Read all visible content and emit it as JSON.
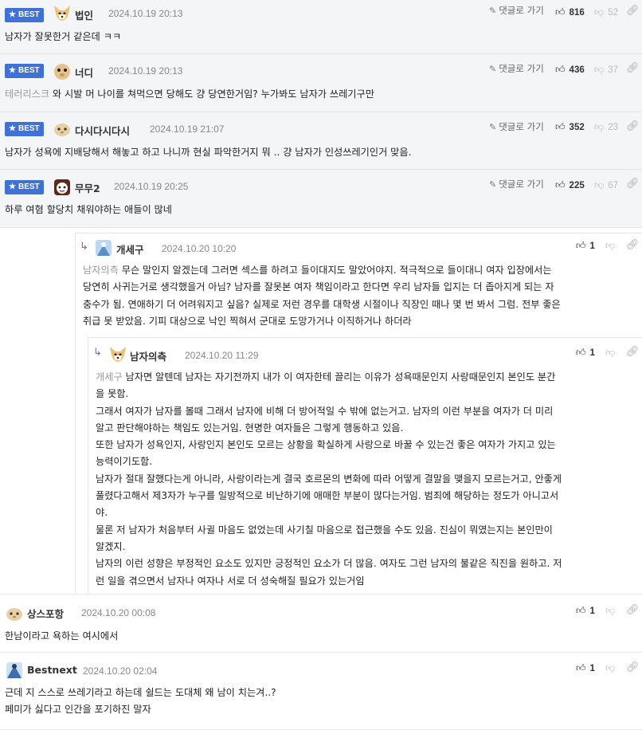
{
  "reply_link_label": "댓글로 가기",
  "badge_label": "BEST",
  "comments": [
    {
      "author": "법인",
      "date": "2024.10.19 20:13",
      "up": "816",
      "down": "52",
      "text": "남자가 잘못한거 같은데 ㅋㅋ"
    },
    {
      "author": "너디",
      "date": "2024.10.19 20:13",
      "up": "436",
      "down": "37",
      "mention": "테러리스크",
      "text": " 와 시발 머 나이를 쳐먹으면 당해도 걍 당연한거임? 누가봐도 남자가 쓰레기구만"
    },
    {
      "author": "다시다시다시",
      "date": "2024.10.19 21:07",
      "up": "352",
      "down": "23",
      "text": "남자가 성욕에 지배당해서 해놓고 하고 나니까 현실 파악한거지 뭐 .. 걍 남자가 인성쓰레기인거 맞음."
    },
    {
      "author": "무무2",
      "date": "2024.10.19 20:25",
      "up": "225",
      "down": "67",
      "text": "하루 여혐 할당치 채워야하는 애들이 많네"
    },
    {
      "author": "개세구",
      "date": "2024.10.20 10:20",
      "up": "1",
      "mention": "남자의측",
      "lines": [
        "무슨 말인지 알겠는데 그러면 섹스를 하려고 들이대지도 말았어야지. 적극적으로 들이대니 여자 입장에서는",
        "당연히 사귀는거로 생각했을거 아님? 남자를 잘못본 여자 책임이라고 한다면 우리 남자들 입지는 더 좁아지게 되는 자",
        "충수가 됨. 연애하기 더 어려워지고 싶음? 실제로 저런 경우를 대학생 시절이나 직장인 때나 몇 번 봐서 그럼. 전부 좋은",
        "취급 못 받았음. 기피 대상으로 낙인 찍혀서 군대로 도망가거나 이직하거나 하더라"
      ]
    },
    {
      "author": "남자의측",
      "date": "2024.10.20 11:29",
      "up": "1",
      "mention": "개세구",
      "lines": [
        "남자면 알텐데 남자는 자기전까지 내가 이 여자한테 끌리는 이유가 성욕때문인지 사랑때문인지 본인도 분간",
        "을 못함.",
        "그래서 여자가 남자를 볼때 그래서 남자에 비해 더 방어적일 수 밖에 없는거고. 남자의 이런 부분을 여자가 더 미리",
        "알고 판단해야하는 책임도 있는거임. 현명한 여자들은 그렇게 행동하고 있음.",
        "또한 남자가 성욕인지, 사랑인지 본인도 모르는 상황을 확실하게 사랑으로 바꿀 수 있는건 좋은 여자가 가지고 있는",
        "능력이기도함.",
        "남자가 절대 잘했다는게 아니라, 사랑이라는게 결국 호르몬의 변화에 따라 어떻게 결말을 맺을지 모르는거고, 안좋게",
        "풀렸다고해서 제3자가 누구를 일방적으로 비난하기에 애매한 부분이 많다는거임. 범죄에 해당하는 정도가 아니고서",
        "야.",
        "물론 저 남자가 처음부터 사귈 마음도 없었는데 사기칠 마음으로 접근했을 수도 있음. 진심이 뭐였는지는 본인만이",
        "알겠지.",
        "남자의 이런 성향은 부정적인 요소도 있지만 긍정적인 요소가 더 많음. 여자도 그런 남자의 불같은 직진을 원하고. 저",
        "런 일을 겪으면서 남자나 여자나 서로 더 성숙해질 필요가 있는거임"
      ]
    },
    {
      "author": "상스포항",
      "date": "2024.10.20 00:08",
      "up": "1",
      "text": "한남이라고 욕하는 여시에서"
    },
    {
      "author": "Bestnext",
      "date": "2024.10.20 02:04",
      "up": "1",
      "lines": [
        "근데 지 스스로 쓰레기라고 하는데 쉴드는 도대체 왜 남이 치는겨..?",
        "페미가 싫다고 인간을 포기하진 말자"
      ]
    }
  ],
  "icons": {
    "star": "star-icon",
    "pen": "pen-icon",
    "thumb_up": "thumbs-up-icon",
    "thumb_down": "thumbs-down-icon",
    "link": "link-icon",
    "reply": "reply-arrow-icon"
  },
  "colors": {
    "badge": "#3f72d6",
    "best_bg": "#f4f5f7",
    "mention": "#999999"
  }
}
